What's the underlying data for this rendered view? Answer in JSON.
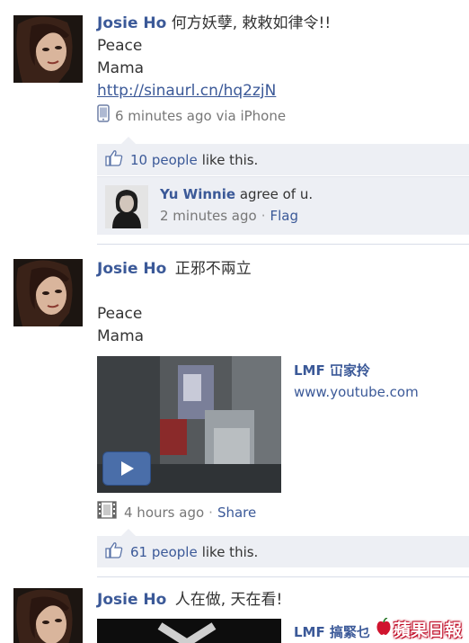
{
  "posts": [
    {
      "author": "Josie Ho",
      "message": "何方妖孽, 敕敕如律令!!",
      "lines": [
        "Peace",
        "Mama"
      ],
      "link": "http://sinaurl.cn/hq2zjN",
      "meta": "6 minutes ago via iPhone",
      "meta_icon": "phone-icon",
      "likes_link": "10 people",
      "likes_rest": "like this.",
      "comment": {
        "author": "Yu Winnie",
        "text": "agree of u.",
        "time": "2 minutes ago",
        "flag": "Flag"
      }
    },
    {
      "author": "Josie Ho",
      "message": "正邪不兩立",
      "lines": [
        "Peace",
        "Mama"
      ],
      "video": {
        "title": "LMF 冚家拎",
        "domain": "www.youtube.com"
      },
      "meta": "4 hours ago",
      "meta_icon": "film-icon",
      "share": "Share",
      "likes_link": "61 people",
      "likes_rest": "like this."
    },
    {
      "author": "Josie Ho",
      "message": "人在做, 天在看!",
      "video_title": "LMF 搞緊乜"
    }
  ],
  "watermark": "蘋果日報",
  "colors": {
    "link_blue": "#3b5998",
    "likes_bg": "#edeff4",
    "meta_gray": "#777777",
    "watermark_red": "#c0102a"
  }
}
